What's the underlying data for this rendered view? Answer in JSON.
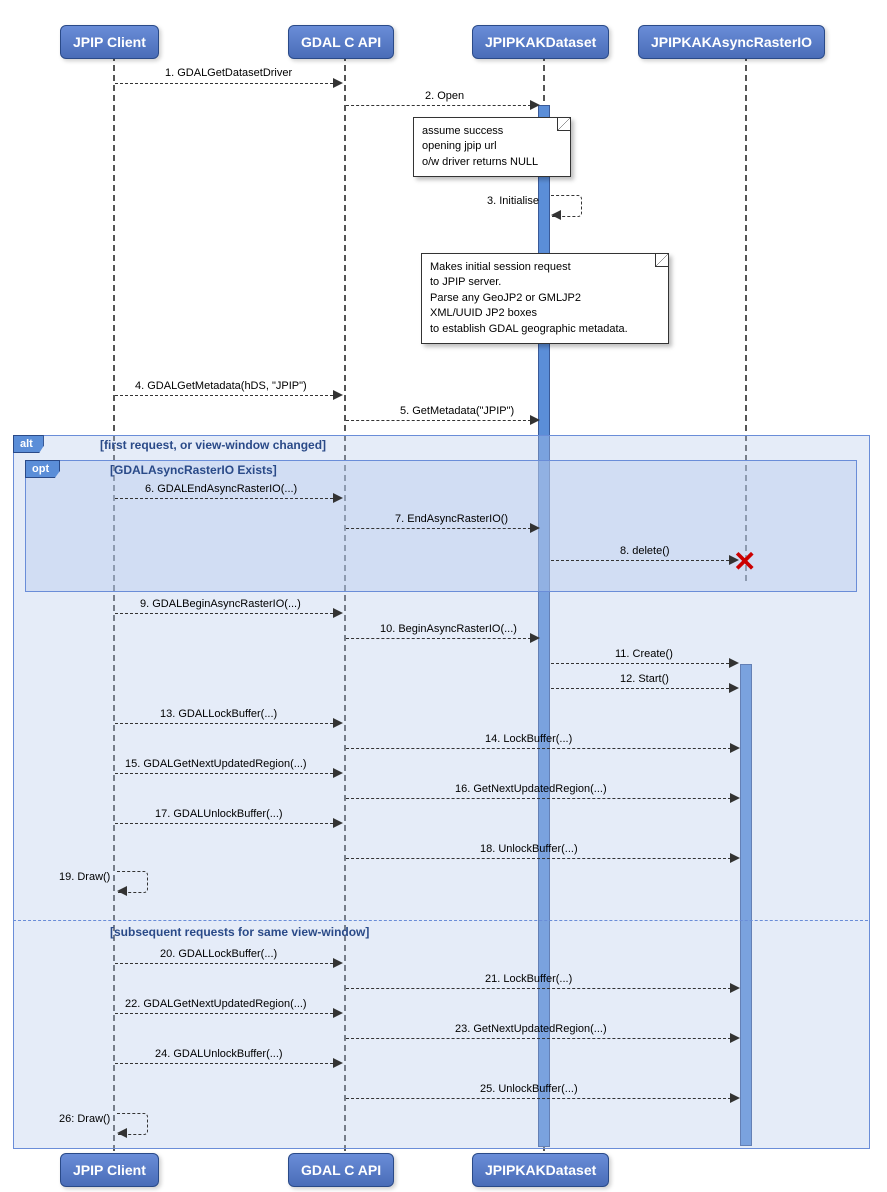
{
  "actors": {
    "client": "JPIP Client",
    "api": "GDAL C API",
    "dataset": "JPIPKAKDataset",
    "async": "JPIPKAKAsyncRasterIO"
  },
  "frames": {
    "alt": "alt",
    "opt": "opt",
    "alt_guard": "[first request, or view-window changed]",
    "opt_guard": "[GDALAsyncRasterIO Exists]",
    "alt_else": "[subsequent requests for same view-window]"
  },
  "notes": {
    "n1l1": "assume success",
    "n1l2": "opening jpip url",
    "n1l3": "o/w driver returns NULL",
    "n2l1": "Makes initial session request",
    "n2l2": "to JPIP server.",
    "n2l3": "Parse any GeoJP2 or GMLJP2",
    "n2l4": "XML/UUID JP2 boxes",
    "n2l5": "to establish GDAL geographic metadata."
  },
  "msgs": {
    "m1": "1. GDALGetDatasetDriver",
    "m2": "2. Open",
    "m3": "3. Initialise",
    "m4": "4. GDALGetMetadata(hDS, \"JPIP\")",
    "m5": "5. GetMetadata(\"JPIP\")",
    "m6": "6. GDALEndAsyncRasterIO(...)",
    "m7": "7. EndAsyncRasterIO()",
    "m8": "8. delete()",
    "m9": "9. GDALBeginAsyncRasterIO(...)",
    "m10": "10. BeginAsyncRasterIO(...)",
    "m11": "11. Create()",
    "m12": "12. Start()",
    "m13": "13. GDALLockBuffer(...)",
    "m14": "14. LockBuffer(...)",
    "m15": "15. GDALGetNextUpdatedRegion(...)",
    "m16": "16. GetNextUpdatedRegion(...)",
    "m17": "17. GDALUnlockBuffer(...)",
    "m18": "18. UnlockBuffer(...)",
    "m19": "19. Draw()",
    "m20": "20. GDALLockBuffer(...)",
    "m21": "21. LockBuffer(...)",
    "m22": "22. GDALGetNextUpdatedRegion(...)",
    "m23": "23. GetNextUpdatedRegion(...)",
    "m24": "24. GDALUnlockBuffer(...)",
    "m25": "25. UnlockBuffer(...)",
    "m26": "26: Draw()"
  }
}
